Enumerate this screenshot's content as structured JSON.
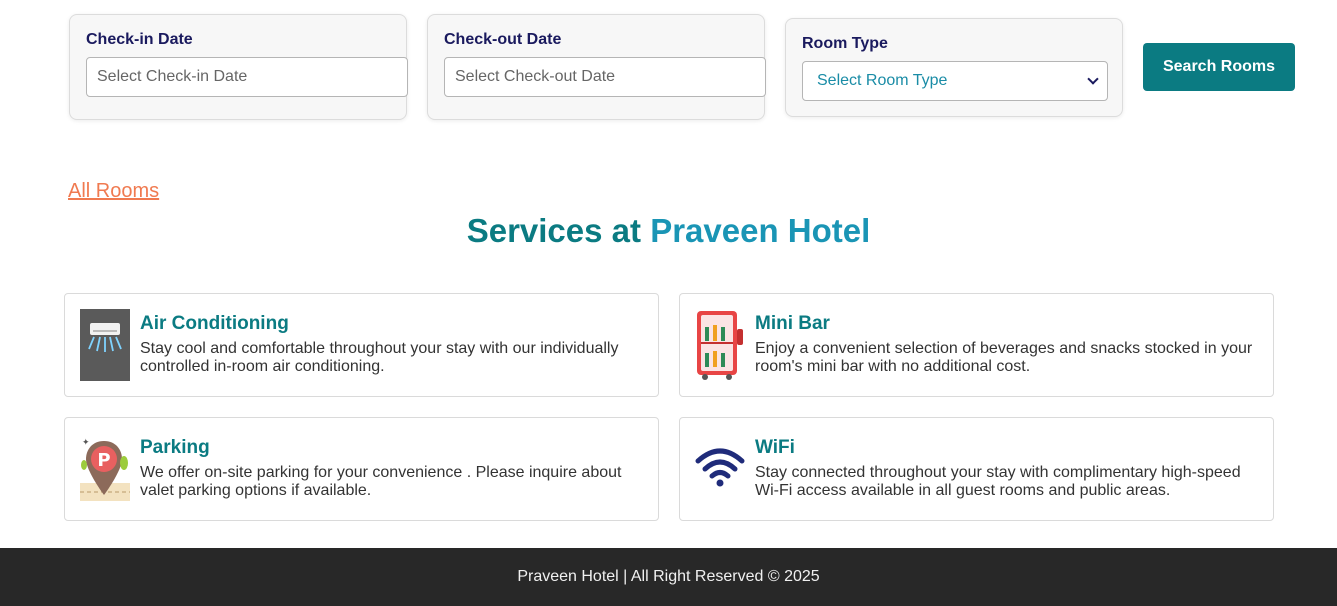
{
  "search": {
    "checkin_label": "Check-in Date",
    "checkin_placeholder": "Select Check-in Date",
    "checkout_label": "Check-out Date",
    "checkout_placeholder": "Select Check-out Date",
    "room_type_label": "Room Type",
    "room_type_selected": "Select Room Type",
    "search_button": "Search Rooms"
  },
  "links": {
    "all_rooms": "All Rooms"
  },
  "services": {
    "title_part1": "Services at",
    "title_part2": "Praveen Hotel",
    "items": [
      {
        "name": "Air Conditioning",
        "description": "Stay cool and comfortable throughout your stay with our individually controlled in-room air conditioning.",
        "icon": "air-conditioner-icon"
      },
      {
        "name": "Mini Bar",
        "description": "Enjoy a convenient selection of beverages and snacks stocked in your room's mini bar with no additional cost.",
        "icon": "mini-fridge-icon"
      },
      {
        "name": "Parking",
        "description": "We offer on-site parking for your convenience . Please inquire about valet parking options if available.",
        "icon": "parking-pin-icon"
      },
      {
        "name": "WiFi",
        "description": "Stay connected throughout your stay with complimentary high-speed Wi-Fi access available in all guest rooms and public areas.",
        "icon": "wifi-icon"
      }
    ]
  },
  "footer": {
    "text": "Praveen Hotel | All Right Reserved © 2025"
  },
  "colors": {
    "teal": "#0b7b82",
    "light_blue": "#1a95b5",
    "link_orange": "#f07a50",
    "label_navy": "#1a1a5e",
    "footer_bg": "#282828"
  }
}
